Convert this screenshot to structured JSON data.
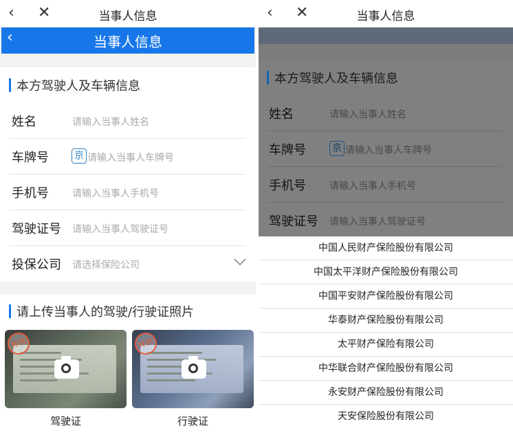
{
  "left": {
    "topbar": {
      "back_icon": "‹",
      "close_icon": "✕",
      "title": "当事人信息"
    },
    "bluebar": {
      "back_icon": "‹",
      "title": "当事人信息"
    },
    "section": "本方驾驶人及车辆信息",
    "fields": [
      {
        "label": "姓名",
        "placeholder": "请输入当事人姓名"
      },
      {
        "label": "车牌号",
        "plate_prefix": "京",
        "placeholder": "请输入当事人车牌号"
      },
      {
        "label": "手机号",
        "placeholder": "请输入当事人手机号"
      },
      {
        "label": "驾驶证号",
        "placeholder": "请输入当事人驾驶证号"
      },
      {
        "label": "投保公司",
        "placeholder": "请选择保险公司",
        "icon": "chevron-down"
      }
    ],
    "upload": {
      "title": "请上传当事人的驾驶/行驶证照片",
      "stamp": "样例",
      "cards": [
        "驾驶证",
        "行驶证"
      ]
    }
  },
  "right": {
    "topbar": {
      "back_icon": "‹",
      "close_icon": "✕",
      "title": "当事人信息"
    },
    "section": "本方驾驶人及车辆信息",
    "fields": [
      {
        "label": "姓名",
        "placeholder": "请输入当事人姓名"
      },
      {
        "label": "车牌号",
        "plate_prefix": "京",
        "placeholder": "请输入当事人车牌号"
      },
      {
        "label": "手机号",
        "placeholder": "请输入当事人手机号"
      },
      {
        "label": "驾驶证号",
        "placeholder": "请输入当事人驾驶证号"
      }
    ],
    "insurance_options": [
      "中国人民财产保险股份有限公司",
      "中国太平洋财产保险股份有限公司",
      "中国平安财产保险股份有限公司",
      "华泰财产保险股份有限公司",
      "太平财产保险有限公司",
      "中华联合财产保险股份有限公司",
      "永安财产保险股份有限公司",
      "天安保险股份有限公司"
    ]
  },
  "colors": {
    "accent": "#1877e8",
    "plate_border": "#2a80c8",
    "placeholder": "#aaaaaa",
    "overlay": "#7c7c7c"
  }
}
